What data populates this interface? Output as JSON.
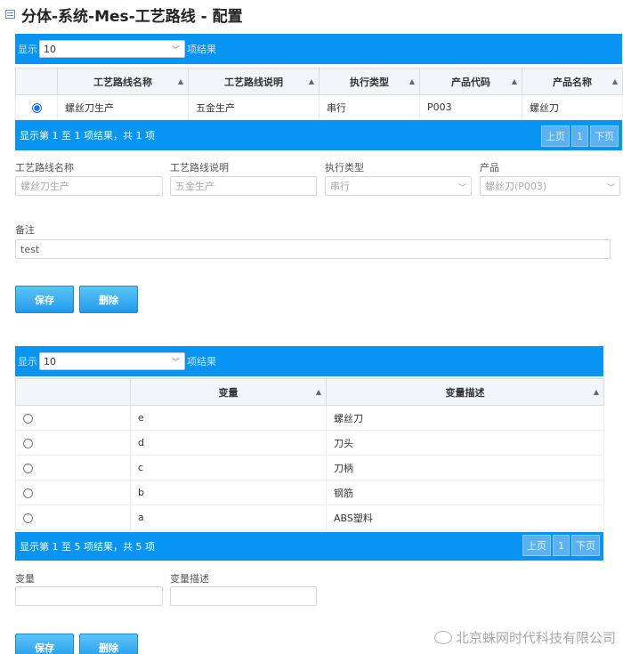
{
  "page": {
    "title": "分体-系统-Mes-工艺路线 - 配置"
  },
  "table1": {
    "show_label": "显示",
    "page_size": "10",
    "results_label": "项结果",
    "columns": [
      "工艺路线名称",
      "工艺路线说明",
      "执行类型",
      "产品代码",
      "产品名称"
    ],
    "rows": [
      {
        "selected": true,
        "cells": [
          "螺丝刀生产",
          "五金生产",
          "串行",
          "P003",
          "螺丝刀"
        ]
      }
    ],
    "info": "显示第 1 至 1 项结果，共 1 项",
    "prev": "上页",
    "page": "1",
    "next": "下页"
  },
  "form1": {
    "name_label": "工艺路线名称",
    "name_value": "螺丝刀生产",
    "desc_label": "工艺路线说明",
    "desc_value": "五金生产",
    "type_label": "执行类型",
    "type_value": "串行",
    "product_label": "产品",
    "product_value": "螺丝刀(P003)",
    "remark_label": "备注",
    "remark_value": "test",
    "save": "保存",
    "delete": "删除"
  },
  "table2": {
    "show_label": "显示",
    "page_size": "10",
    "results_label": "项结果",
    "columns": [
      "变量",
      "变量描述"
    ],
    "rows": [
      {
        "selected": false,
        "cells": [
          "e",
          "螺丝刀"
        ]
      },
      {
        "selected": false,
        "cells": [
          "d",
          "刀头"
        ]
      },
      {
        "selected": false,
        "cells": [
          "c",
          "刀柄"
        ]
      },
      {
        "selected": false,
        "cells": [
          "b",
          "钢筋"
        ]
      },
      {
        "selected": false,
        "cells": [
          "a",
          "ABS塑料"
        ]
      }
    ],
    "info": "显示第 1 至 5 项结果，共 5 项",
    "prev": "上页",
    "page": "1",
    "next": "下页"
  },
  "form2": {
    "var_label": "变量",
    "var_value": "",
    "desc_label": "变量描述",
    "desc_value": "",
    "save": "保存",
    "delete": "删除"
  },
  "watermark": {
    "text": "北京蛛网时代科技有限公司"
  }
}
